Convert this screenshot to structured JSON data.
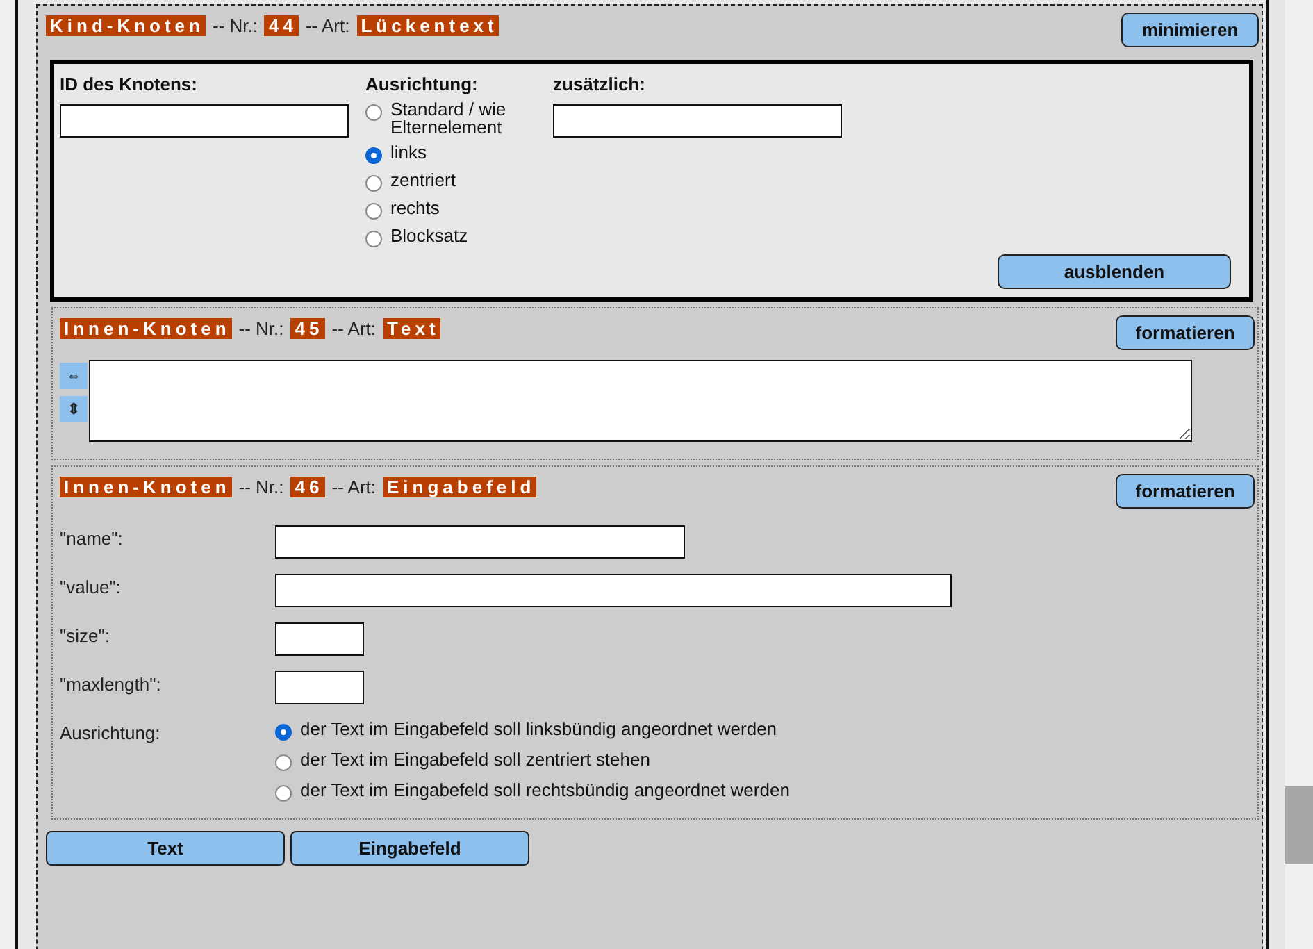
{
  "node": {
    "tag": "Kind-Knoten",
    "nr_label": "-- Nr.:",
    "nr": "44",
    "art_label": "-- Art:",
    "art": "Lückentext",
    "button": "minimieren"
  },
  "attributes": {
    "id_field": {
      "label": "ID des Knotens:"
    },
    "alignment": {
      "label": "Ausrichtung:",
      "options": [
        {
          "label": "Standard / wie Elternelement",
          "selected": false
        },
        {
          "label": "links",
          "selected": true
        },
        {
          "label": "zentriert",
          "selected": false
        },
        {
          "label": "rechts",
          "selected": false
        },
        {
          "label": "Blocksatz",
          "selected": false
        }
      ]
    },
    "extra_field": {
      "label": "zusätzlich:"
    },
    "button": "ausblenden"
  },
  "children": [
    {
      "kind": "text",
      "tag": "Innen-Knoten",
      "nr_label": "-- Nr.:",
      "nr": "45",
      "art_label": "-- Art:",
      "art": "Text",
      "button": "formatieren",
      "tools": [
        "⇔",
        "⇕"
      ]
    },
    {
      "kind": "input",
      "tag": "Innen-Knoten",
      "nr_label": "-- Nr.:",
      "nr": "46",
      "art_label": "-- Art:",
      "art": "Eingabefeld",
      "button": "formatieren",
      "fields": [
        {
          "label": "\"name\":"
        },
        {
          "label": "\"value\":"
        },
        {
          "label": "\"size\":"
        },
        {
          "label": "\"maxlength\":"
        }
      ],
      "alignment": {
        "label": "Ausrichtung:",
        "options": [
          {
            "label": "der Text im Eingabefeld soll linksbündig angeordnet werden",
            "selected": true
          },
          {
            "label": "der Text im Eingabefeld soll zentriert stehen",
            "selected": false
          },
          {
            "label": "der Text im Eingabefeld soll rechtsbündig angeordnet werden",
            "selected": false
          }
        ]
      }
    }
  ],
  "footer_buttons": [
    "Text",
    "Eingabefeld"
  ]
}
